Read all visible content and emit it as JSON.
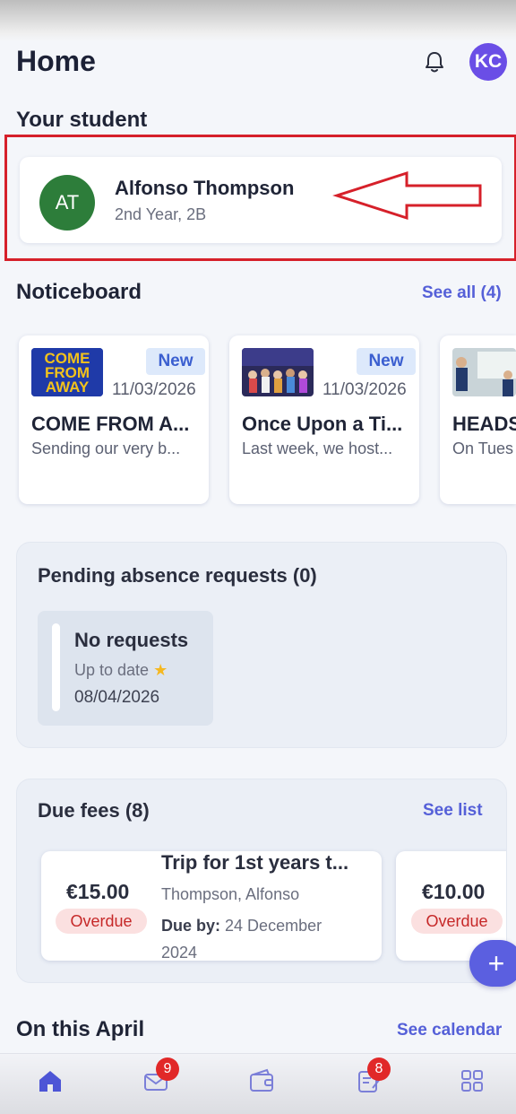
{
  "header": {
    "title": "Home",
    "avatar_initials": "KC"
  },
  "student_section": {
    "title": "Your student",
    "student": {
      "initials": "AT",
      "name": "Alfonso Thompson",
      "class": "2nd Year, 2B"
    }
  },
  "noticeboard": {
    "title": "Noticeboard",
    "see_all": "See all (4)",
    "items": [
      {
        "badge": "New",
        "date": "11/03/2026",
        "title": "COME FROM A...",
        "desc": "Sending our very b...",
        "thumb_text": [
          "COME",
          "FROM",
          "AWAY"
        ]
      },
      {
        "badge": "New",
        "date": "11/03/2026",
        "title": "Once Upon a Ti...",
        "desc": "Last week, we host..."
      },
      {
        "title": "HEADS",
        "desc": "On Tues"
      }
    ]
  },
  "absence": {
    "title": "Pending absence requests (0)",
    "card": {
      "title": "No requests",
      "subtitle": "Up to date",
      "date": "08/04/2026"
    }
  },
  "fees": {
    "title": "Due fees (8)",
    "see_list": "See list",
    "items": [
      {
        "amount": "€15.00",
        "status": "Overdue",
        "title": "Trip for 1st years t...",
        "student": "Thompson, Alfonso",
        "due_label": "Due by:",
        "due_date": "24 December 2024"
      },
      {
        "amount": "€10.00",
        "status": "Overdue"
      }
    ]
  },
  "calendar": {
    "title": "On this April",
    "see_calendar": "See calendar"
  },
  "bottom_nav": {
    "messages_count": "9",
    "forms_count": "8"
  },
  "colors": {
    "accent": "#5b5fe0",
    "overdue": "#c62828",
    "highlight": "#d6202a"
  }
}
